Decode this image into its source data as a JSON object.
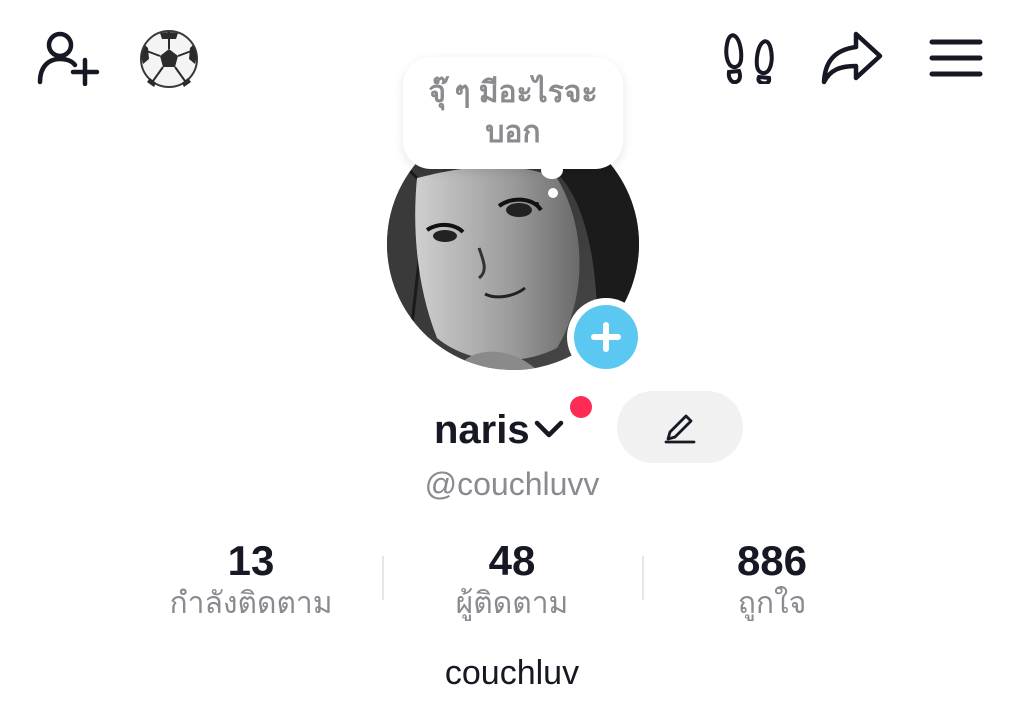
{
  "status_bubble": {
    "text": "จุ๊ ๆ มีอะไรจะบอก"
  },
  "profile": {
    "username": "naris",
    "handle": "@couchluvv",
    "bio": "couchluv"
  },
  "stats": [
    {
      "value": "13",
      "label": "กำลังติดตาม"
    },
    {
      "value": "48",
      "label": "ผู้ติดตาม"
    },
    {
      "value": "886",
      "label": "ถูกใจ"
    }
  ],
  "icons": {
    "top_left": [
      "add-friend-icon",
      "soccer-ball-icon"
    ],
    "top_right": [
      "footprints-icon",
      "share-icon",
      "menu-icon"
    ],
    "avatar_badge": "plus-icon",
    "username_dropdown": "chevron-down-icon",
    "edit": "pencil-icon"
  },
  "colors": {
    "accent_blue": "#5ac8f0",
    "notification_red": "#fe2c55",
    "muted_text": "#8a8b91",
    "primary_text": "#161823",
    "button_bg": "#f1f1f2"
  }
}
